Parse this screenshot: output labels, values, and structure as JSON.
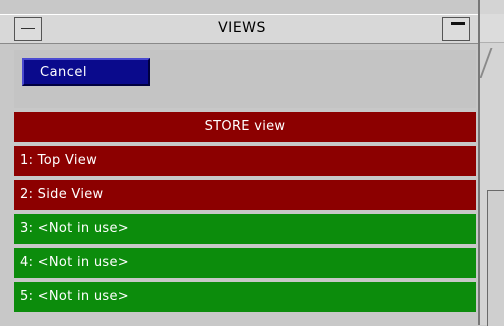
{
  "window": {
    "title": "VIEWS"
  },
  "toolbar": {
    "cancel_label": "Cancel"
  },
  "list": {
    "store_label": "STORE view",
    "items": [
      {
        "label": "1: Top View",
        "state": "used"
      },
      {
        "label": "2: Side View",
        "state": "used"
      },
      {
        "label": "3: <Not in use>",
        "state": "free"
      },
      {
        "label": "4: <Not in use>",
        "state": "free"
      },
      {
        "label": "5: <Not in use>",
        "state": "free"
      }
    ]
  },
  "colors": {
    "used_row": "#8c0000",
    "free_row": "#0c8c0c",
    "cancel_button": "#0a0a8c"
  }
}
